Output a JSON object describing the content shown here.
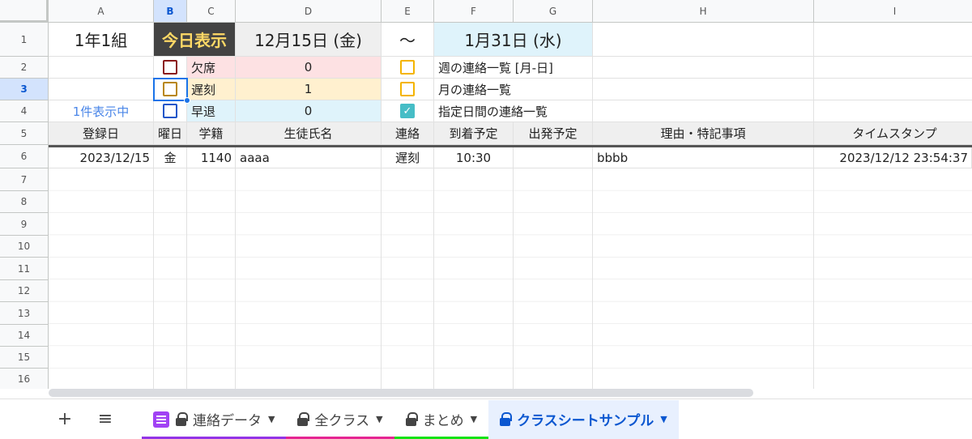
{
  "columns": [
    "A",
    "B",
    "C",
    "D",
    "E",
    "F",
    "G",
    "H",
    "I"
  ],
  "rows": [
    "1",
    "2",
    "3",
    "4",
    "5",
    "6",
    "7",
    "8",
    "9",
    "10",
    "11",
    "12",
    "13",
    "14",
    "15",
    "16"
  ],
  "row1": {
    "class_name": "1年1組",
    "today_button": "今日表示",
    "start_date": "12月15日 (金)",
    "tilde": "～",
    "end_date": "1月31日 (水)"
  },
  "status": [
    {
      "label": "欠席",
      "count": "0",
      "color": "#8b1a1a"
    },
    {
      "label": "遅刻",
      "count": "1",
      "color": "#b8860b"
    },
    {
      "label": "早退",
      "count": "0",
      "color": "#1a56c9"
    }
  ],
  "display_count": "1件表示中",
  "views": [
    {
      "label": "週の連絡一覧 [月-日]",
      "checked": false
    },
    {
      "label": "月の連絡一覧",
      "checked": false
    },
    {
      "label": "指定日間の連絡一覧",
      "checked": true
    }
  ],
  "headers": [
    "登録日",
    "曜日",
    "学籍",
    "生徒氏名",
    "連絡",
    "到着予定",
    "出発予定",
    "理由・特記事項",
    "タイムスタンプ"
  ],
  "record": {
    "date": "2023/12/15",
    "weekday": "金",
    "student_id": "1140",
    "name": "aaaa",
    "contact": "遅刻",
    "arrival": "10:30",
    "departure": "",
    "reason": "bbbb",
    "timestamp": "2023/12/12 23:54:37"
  },
  "tabs": [
    {
      "label": "連絡データ",
      "underline": "#9334e6"
    },
    {
      "label": "全クラス",
      "underline": "#e52592"
    },
    {
      "label": "まとめ",
      "underline": "#12e312"
    },
    {
      "label": "クラスシートサンプル",
      "underline": ""
    }
  ],
  "colors": {
    "accent": "#1a73e8",
    "checkbox_checked": "#46bdc6",
    "view_checkbox": "#f4b400"
  }
}
